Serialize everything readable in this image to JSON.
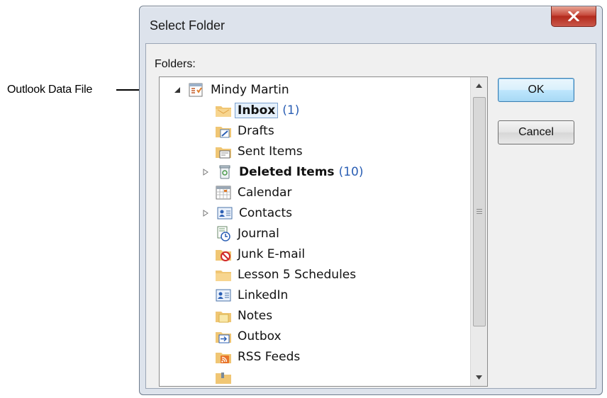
{
  "callout": {
    "label": "Outlook Data File"
  },
  "dialog": {
    "title": "Select Folder",
    "folders_label": "Folders:",
    "ok_label": "OK",
    "cancel_label": "Cancel"
  },
  "tree": {
    "root": {
      "label": "Mindy Martin",
      "icon": "outlook-data-file-icon",
      "expanded": true
    },
    "items": [
      {
        "label": "Inbox",
        "count": "(1)",
        "bold": true,
        "selected": true,
        "icon": "inbox-folder-icon"
      },
      {
        "label": "Drafts",
        "count": "",
        "icon": "drafts-folder-icon"
      },
      {
        "label": "Sent Items",
        "count": "",
        "icon": "sent-items-folder-icon"
      },
      {
        "label": "Deleted Items",
        "count": "(10)",
        "bold": true,
        "expandable": true,
        "icon": "deleted-items-icon"
      },
      {
        "label": "Calendar",
        "count": "",
        "icon": "calendar-icon"
      },
      {
        "label": "Contacts",
        "count": "",
        "expandable": true,
        "icon": "contacts-icon"
      },
      {
        "label": "Journal",
        "count": "",
        "icon": "journal-icon"
      },
      {
        "label": "Junk E-mail",
        "count": "",
        "icon": "junk-email-icon"
      },
      {
        "label": "Lesson 5 Schedules",
        "count": "",
        "icon": "folder-icon"
      },
      {
        "label": "LinkedIn",
        "count": "",
        "icon": "contacts-icon"
      },
      {
        "label": "Notes",
        "count": "",
        "icon": "notes-folder-icon"
      },
      {
        "label": "Outbox",
        "count": "",
        "icon": "outbox-folder-icon"
      },
      {
        "label": "RSS Feeds",
        "count": "",
        "icon": "rss-feeds-icon"
      }
    ]
  }
}
